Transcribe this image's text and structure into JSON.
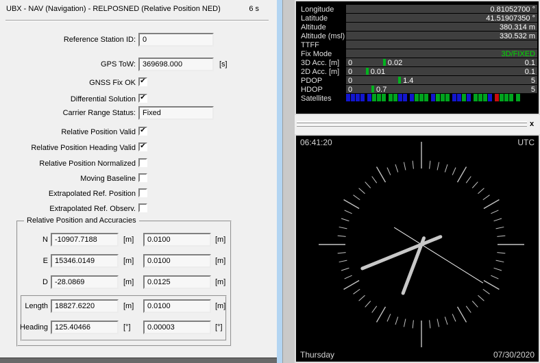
{
  "left_panel": {
    "title": "UBX - NAV (Navigation) - RELPOSNED (Relative Position NED)",
    "age": "6 s",
    "ref_station": {
      "label": "Reference Station ID:",
      "value": "0"
    },
    "gps_tow": {
      "label": "GPS ToW:",
      "value": "369698.000",
      "unit": "[s]"
    },
    "carrier": {
      "label": "Carrier Range Status:",
      "value": "Fixed"
    },
    "checkboxes": [
      {
        "label": "GNSS Fix OK",
        "checked": true
      },
      {
        "label": "Differential Solution",
        "checked": true
      },
      {
        "label": "Relative Position Valid",
        "checked": true
      },
      {
        "label": "Relative Position Heading Valid",
        "checked": true
      },
      {
        "label": "Relative Position Normalized",
        "checked": false
      },
      {
        "label": "Moving Baseline",
        "checked": false
      },
      {
        "label": "Extrapolated Ref. Position",
        "checked": false
      },
      {
        "label": "Extrapolated Ref. Observ.",
        "checked": false
      }
    ],
    "group": {
      "title": "Relative Position and Accuracies",
      "rows": [
        {
          "label": "N",
          "value": "-10907.7188",
          "unit": "[m]",
          "acc": "0.0100",
          "acc_unit": "[m]"
        },
        {
          "label": "E",
          "value": "15346.0149",
          "unit": "[m]",
          "acc": "0.0100",
          "acc_unit": "[m]"
        },
        {
          "label": "D",
          "value": "-28.0869",
          "unit": "[m]",
          "acc": "0.0125",
          "acc_unit": "[m]"
        }
      ],
      "vector_rows": [
        {
          "label": "Length",
          "value": "18827.6220",
          "unit": "[m]",
          "acc": "0.0100",
          "acc_unit": "[m]"
        },
        {
          "label": "Heading",
          "value": "125.40466",
          "unit": "[°]",
          "acc": "0.00003",
          "acc_unit": "[°]"
        }
      ]
    }
  },
  "data_panel": {
    "rows": [
      {
        "label": "Longitude",
        "value": "0.81052700 °",
        "color": "#ffffff"
      },
      {
        "label": "Latitude",
        "value": "41.51907350 °",
        "color": "#ffffff"
      },
      {
        "label": "Altitude",
        "value": "380.314 m",
        "color": "#ffffff"
      },
      {
        "label": "Altitude (msl)",
        "value": "330.532 m",
        "color": "#ffffff"
      },
      {
        "label": "TTFF",
        "value": "",
        "color": "#ffffff"
      },
      {
        "label": "Fix Mode",
        "value": "3D/FIXED",
        "color": "#00dc00"
      }
    ],
    "bars": [
      {
        "label": "3D Acc. [m]",
        "min": "0",
        "max": "0.1",
        "marker_label": "0.02",
        "marker_frac": 0.2
      },
      {
        "label": "2D Acc. [m]",
        "min": "0",
        "max": "0.1",
        "marker_label": "0.01",
        "marker_frac": 0.11
      },
      {
        "label": "PDOP",
        "min": "0",
        "max": "5",
        "marker_label": "1.4",
        "marker_frac": 0.28
      },
      {
        "label": "HDOP",
        "min": "0",
        "max": "5",
        "marker_label": "0.7",
        "marker_frac": 0.14
      }
    ],
    "satellites": {
      "label": "Satellites",
      "colors": {
        "blue": "#1216cf",
        "green": "#00a41e",
        "red": "#cb0d0d"
      },
      "squares": [
        "blue",
        "blue",
        "blue",
        "blue",
        "blue",
        "green",
        "green",
        "green",
        "green",
        "green",
        "blue",
        "blue",
        "blue",
        "green",
        "green",
        "green",
        "blue",
        "green",
        "green",
        "green",
        "blue",
        "blue",
        "green",
        "blue",
        "green",
        "green",
        "green",
        "blue",
        "red",
        "green",
        "green",
        "green",
        "green"
      ]
    }
  },
  "splitter": {
    "close_glyph": "x"
  },
  "clock_panel": {
    "time": "06:41:20",
    "timezone": "UTC",
    "weekday": "Thursday",
    "date": "07/30/2020",
    "hands": {
      "hour_deg": 200.7,
      "minute_deg": 247.9,
      "second_deg": 122
    },
    "colors": {
      "tick": "#c4c4c4",
      "hand": "#c8c8c8",
      "second": "#efefef"
    }
  }
}
